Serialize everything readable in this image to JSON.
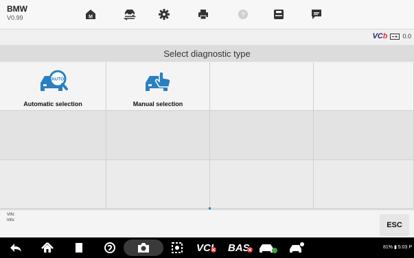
{
  "header": {
    "brand": "BMW",
    "version": "V0.99"
  },
  "toolbar": {
    "items": [
      {
        "icon": "home-icon",
        "letter": "M"
      },
      {
        "icon": "vehicle-swap-icon"
      },
      {
        "icon": "settings-gear-icon"
      },
      {
        "icon": "print-icon"
      },
      {
        "icon": "help-icon",
        "disabled": true
      },
      {
        "icon": "save-icon"
      },
      {
        "icon": "message-icon"
      }
    ]
  },
  "status": {
    "vci_brand_main": "VC",
    "vci_brand_suffix": "b",
    "vci_value": "0.0"
  },
  "page": {
    "title": "Select diagnostic type"
  },
  "options": [
    {
      "label": "Automatic selection",
      "icon": "car-auto-search-icon",
      "badge": "AUTO"
    },
    {
      "label": "Manual selection",
      "icon": "car-manual-touch-icon"
    }
  ],
  "info": {
    "vin_label": "VIN:",
    "info_label": "Info:",
    "esc_label": "ESC"
  },
  "navbar": {
    "labels": {
      "vci": "VCI",
      "bas": "BAS"
    },
    "status_text": "81% ▮ 5:03 P"
  },
  "colors": {
    "accent": "#1e7de0",
    "vci_brand": "#1f2a6b",
    "alert": "#e53935",
    "ok": "#43a047"
  }
}
